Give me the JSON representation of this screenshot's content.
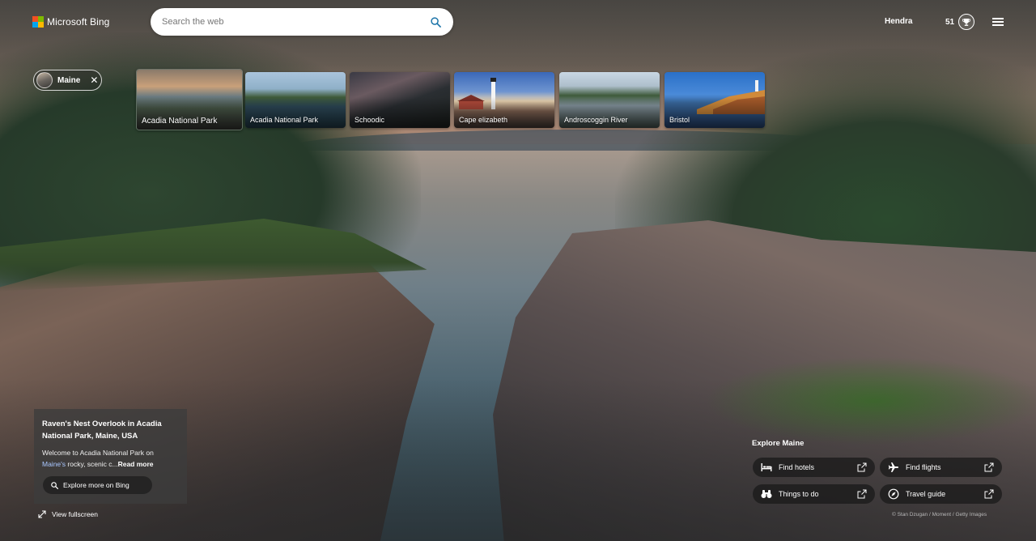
{
  "header": {
    "brand": "Microsoft Bing",
    "search_placeholder": "Search the web",
    "user_name": "Hendra",
    "rewards_points": "51",
    "logo_colors": [
      "#f25022",
      "#7fba00",
      "#00a4ef",
      "#ffb900"
    ]
  },
  "location_chip": {
    "label": "Maine",
    "close_glyph": "✕"
  },
  "carousel": {
    "items": [
      {
        "label": "Acadia National Park",
        "active": true
      },
      {
        "label": "Acadia National Park",
        "active": false
      },
      {
        "label": "Schoodic",
        "active": false
      },
      {
        "label": "Cape elizabeth",
        "active": false
      },
      {
        "label": "Androscoggin River",
        "active": false
      },
      {
        "label": "Bristol",
        "active": false
      }
    ]
  },
  "info": {
    "title": "Raven's Nest Overlook in Acadia National Park, Maine, USA",
    "desc_intro": "Welcome to Acadia National Park on ",
    "desc_link": "Maine's",
    "desc_rest": " rocky, scenic c...",
    "read_more": "Read more",
    "explore_button": "Explore more on Bing"
  },
  "fullscreen_label": "View fullscreen",
  "explore": {
    "title": "Explore Maine",
    "buttons": [
      {
        "label": "Find hotels",
        "icon": "bed-icon"
      },
      {
        "label": "Find flights",
        "icon": "airplane-icon"
      },
      {
        "label": "Things to do",
        "icon": "binoculars-icon"
      },
      {
        "label": "Travel guide",
        "icon": "compass-icon"
      }
    ]
  },
  "credit": "© Stan Dzugan / Moment / Getty Images"
}
